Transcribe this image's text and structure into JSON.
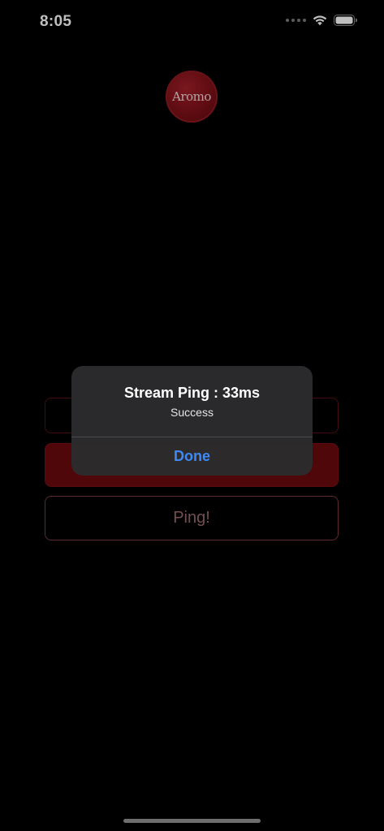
{
  "status_bar": {
    "time": "8:05"
  },
  "logo": {
    "text": "Aromo"
  },
  "buttons": {
    "ping_label": "Ping!"
  },
  "alert": {
    "title": "Stream Ping : 33ms",
    "message": "Success",
    "action_label": "Done"
  },
  "colors": {
    "accent_red": "#6a0a0e",
    "alert_action": "#3d8af7",
    "background": "#000000"
  }
}
